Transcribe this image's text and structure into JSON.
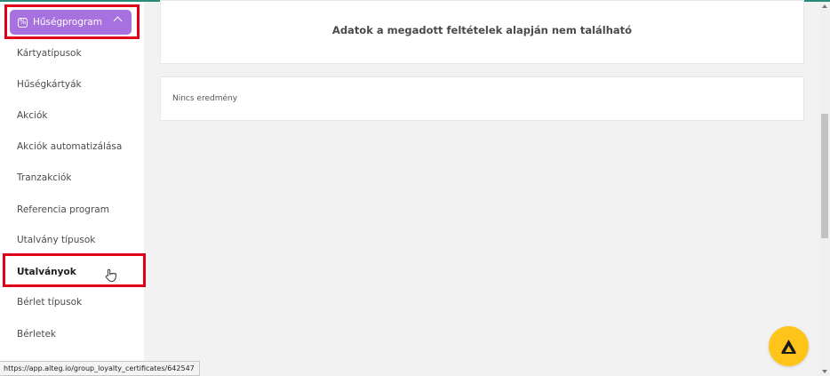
{
  "sidebar": {
    "menu": {
      "label": "Hűségprogram",
      "icon": "percent-icon",
      "chevron": "chevron-up-icon"
    },
    "items": [
      {
        "label": "Kártyatípusok"
      },
      {
        "label": "Hűségkártyák"
      },
      {
        "label": "Akciók"
      },
      {
        "label": "Akciók automatizálása"
      },
      {
        "label": "Tranzakciók"
      },
      {
        "label": "Referencia program"
      },
      {
        "label": "Utalvány típusok"
      },
      {
        "label": "Utalványok",
        "active": true
      },
      {
        "label": "Bérlet típusok"
      },
      {
        "label": "Bérletek"
      }
    ]
  },
  "main": {
    "empty_message": "Adatok a megadott feltételek alapján nem található",
    "no_results": "Nincs eredmény"
  },
  "statusbar": {
    "url": "https://app.alteg.io/group_loyalty_certificates/642547"
  },
  "colors": {
    "accent": "#a772e0",
    "highlight": "#e0001a",
    "fab": "#ffc41a"
  }
}
